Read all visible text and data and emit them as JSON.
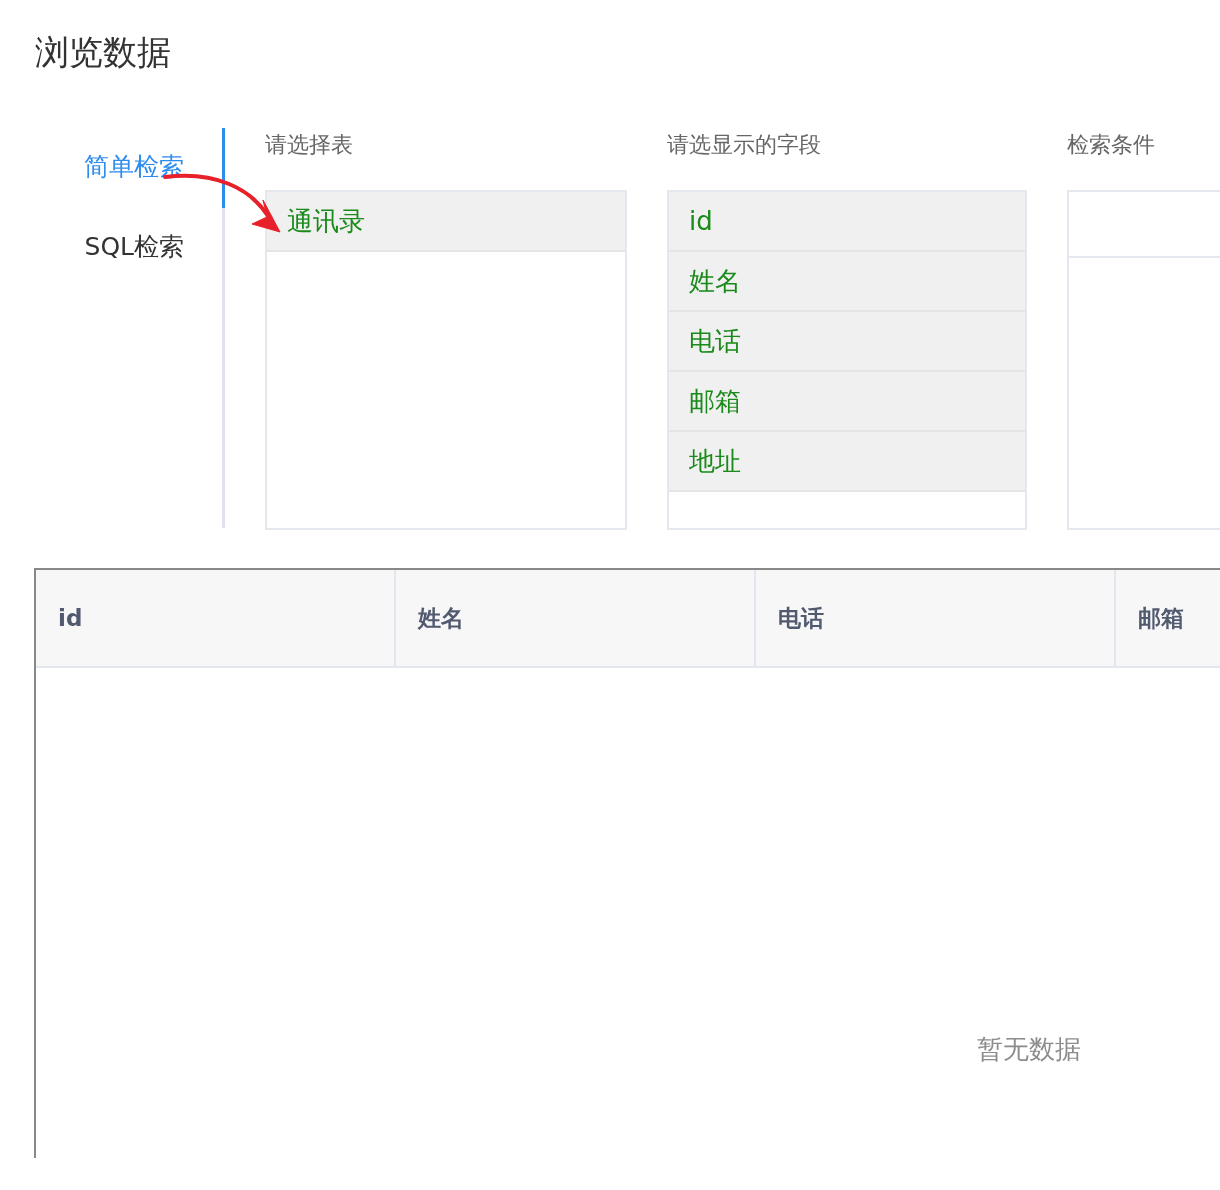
{
  "page": {
    "title": "浏览数据"
  },
  "tabs": [
    {
      "label": "简单检索",
      "selected": true
    },
    {
      "label": "SQL检索",
      "selected": false
    }
  ],
  "tables_panel": {
    "label": "请选择表",
    "items": [
      {
        "label": "通讯录",
        "selected": true
      }
    ]
  },
  "fields_panel": {
    "label": "请选显示的字段",
    "items": [
      {
        "label": "id",
        "selected": true
      },
      {
        "label": "姓名",
        "selected": true
      },
      {
        "label": "电话",
        "selected": true
      },
      {
        "label": "邮箱",
        "selected": true
      },
      {
        "label": "地址",
        "selected": true
      }
    ]
  },
  "conditions_panel": {
    "label": "检索条件"
  },
  "table": {
    "columns": [
      "id",
      "姓名",
      "电话",
      "邮箱"
    ],
    "empty_text": "暂无数据"
  }
}
